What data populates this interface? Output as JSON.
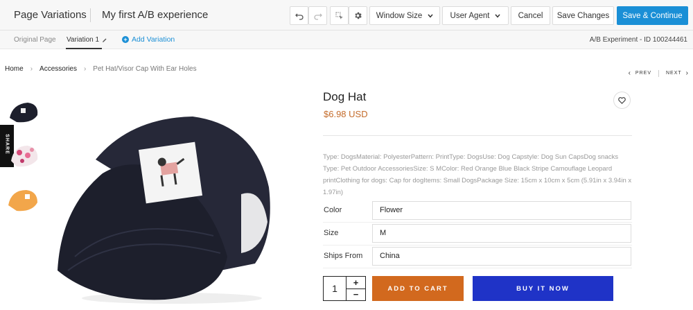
{
  "editor": {
    "title": "Page Variations",
    "experience_name": "My first A/B experience",
    "window_size_label": "Window Size",
    "user_agent_label": "User Agent",
    "cancel_label": "Cancel",
    "save_changes_label": "Save Changes",
    "save_continue_label": "Save & Continue",
    "icons": [
      "undo-icon",
      "redo-icon",
      "select-element-icon",
      "gear-icon"
    ]
  },
  "variations": {
    "original_label": "Original Page",
    "variation_label": "Variation 1",
    "add_label": "Add Variation",
    "experiment_id": "A/B Experiment - ID 100244461"
  },
  "breadcrumb": {
    "home": "Home",
    "category": "Accessories",
    "current": "Pet Hat/Visor Cap With Ear Holes"
  },
  "pager": {
    "prev": "PREV",
    "next": "NEXT"
  },
  "share_label": "SHARE",
  "product": {
    "title": "Dog Hat",
    "price": "$6.98 USD",
    "description": "Type: DogsMaterial: PolyesterPattern: PrintType: DogsUse: Dog Capstyle: Dog Sun CapsDog snacks Type: Pet Outdoor AccessoriesSize: S MColor: Red Orange Blue Black Stripe Camouflage Leopard printClothing for dogs: Cap for dogItems: Small DogsPackage Size: 15cm x 10cm x 5cm (5.91in x 3.94in x 1.97in)",
    "options": [
      {
        "label": "Color",
        "value": "Flower"
      },
      {
        "label": "Size",
        "value": "M"
      },
      {
        "label": "Ships From",
        "value": "China"
      }
    ],
    "quantity": "1",
    "add_to_cart_label": "ADD TO CART",
    "buy_now_label": "BUY IT NOW"
  },
  "colors": {
    "primary_blue": "#1a8fd6",
    "price_orange": "#c46b2a",
    "cart_orange": "#d2691e",
    "buy_blue": "#1f33c7"
  }
}
